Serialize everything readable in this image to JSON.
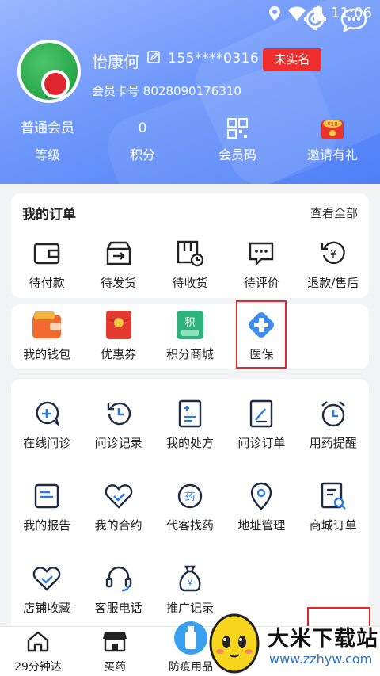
{
  "status_bar": {
    "time": "11:06"
  },
  "profile": {
    "name": "怡康何",
    "phone": "155****0316",
    "verify_badge": "未实名",
    "card_label": "会员卡号",
    "card_number": "8028090176310"
  },
  "stats": [
    {
      "value": "普通会员",
      "label": "等级"
    },
    {
      "value": "0",
      "label": "积分"
    },
    {
      "value": "",
      "label": "会员码"
    },
    {
      "value": "",
      "label": "邀请有礼"
    }
  ],
  "orders": {
    "title": "我的订单",
    "view_all": "查看全部",
    "items": [
      {
        "label": "待付款",
        "icon": "wallet-icon"
      },
      {
        "label": "待发货",
        "icon": "box-send-icon"
      },
      {
        "label": "待收货",
        "icon": "package-clock-icon"
      },
      {
        "label": "待评价",
        "icon": "comment-icon"
      },
      {
        "label": "退款/售后",
        "icon": "refund-icon"
      }
    ]
  },
  "wallet_row": [
    {
      "label": "我的钱包",
      "icon": "wallet-orange-icon"
    },
    {
      "label": "优惠券",
      "icon": "coupon-red-icon"
    },
    {
      "label": "积分商城",
      "icon": "points-green-icon"
    },
    {
      "label": "医保",
      "icon": "medical-insurance-icon"
    }
  ],
  "tools": [
    {
      "label": "在线问诊",
      "icon": "consult-icon"
    },
    {
      "label": "问诊记录",
      "icon": "history-icon"
    },
    {
      "label": "我的处方",
      "icon": "prescription-icon"
    },
    {
      "label": "问诊订单",
      "icon": "consult-order-icon"
    },
    {
      "label": "用药提醒",
      "icon": "alarm-icon"
    },
    {
      "label": "我的报告",
      "icon": "report-icon"
    },
    {
      "label": "我的合约",
      "icon": "handshake-icon"
    },
    {
      "label": "代客找药",
      "icon": "find-medicine-icon"
    },
    {
      "label": "地址管理",
      "icon": "location-icon"
    },
    {
      "label": "商城订单",
      "icon": "mall-order-icon"
    },
    {
      "label": "店铺收藏",
      "icon": "heart-check-icon"
    },
    {
      "label": "客服电话",
      "icon": "headset-icon"
    },
    {
      "label": "推广记录",
      "icon": "money-bag-icon"
    }
  ],
  "tabbar": [
    {
      "label": "29分钟达",
      "icon": "home-icon"
    },
    {
      "label": "买药",
      "icon": "shop-icon"
    },
    {
      "label": "防疫用品",
      "icon": "sanitizer-icon"
    }
  ],
  "watermark": {
    "brand": "大米下载站",
    "url": "www.zzhyw.com"
  },
  "colors": {
    "accent": "#4f7ff8",
    "badge_red": "#ef2d2a",
    "icon_blue": "#2a7ae4"
  }
}
